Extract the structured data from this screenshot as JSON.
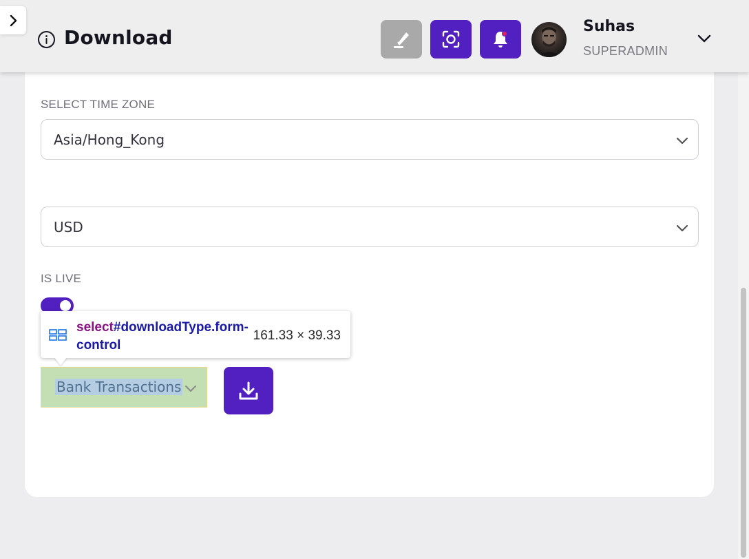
{
  "header": {
    "title": "Download",
    "user": {
      "name": "Suhas",
      "role": "SUPERADMIN"
    },
    "buttons": {
      "highlighter_icon": "highlighter-icon",
      "screenshot_icon": "screen-capture-icon",
      "notification_icon": "bell-icon"
    }
  },
  "form": {
    "time_zone_label": "SELECT TIME ZONE",
    "time_zone_value": "Asia/Hong_Kong",
    "currency_value": "USD",
    "is_live_label": "IS LIVE",
    "is_live_on": true,
    "download_type_value": "Bank Transactions"
  },
  "inspector_tooltip": {
    "tag": "select",
    "selector_rest": "#downloadType.form-control",
    "size": "161.33 × 39.33"
  },
  "colors": {
    "accent": "#5220c0",
    "gray_button": "#a9a9a9",
    "highlight_content": "#c3dfb3",
    "highlight_text": "#b4cde3"
  }
}
